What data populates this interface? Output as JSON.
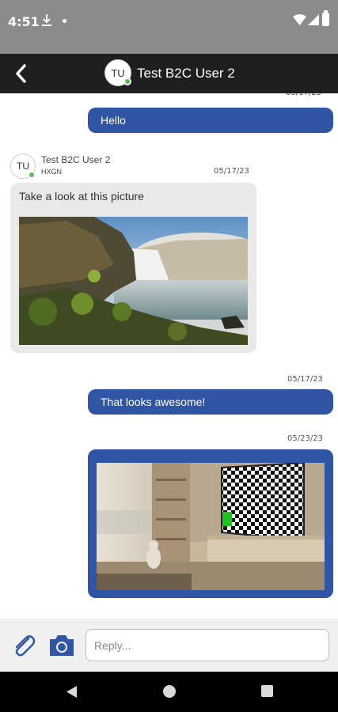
{
  "status_bar": {
    "time": "4:51",
    "icons": [
      "download-icon",
      "dot-icon",
      "wifi-icon",
      "signal-icon",
      "battery-icon"
    ]
  },
  "header": {
    "avatar_initials": "TU",
    "title": "Test B2C User 2",
    "back_icon": "chevron-left-icon",
    "background": "#1f1f1f"
  },
  "messages": [
    {
      "direction": "outgoing",
      "text": "Hello"
    },
    {
      "direction": "incoming",
      "sender": {
        "initials": "TU",
        "name": "Test B2C User 2",
        "org": "HXGN"
      },
      "timestamp": "05/17/23",
      "text": "Take a look at this picture",
      "image": "waterfall-photo"
    },
    {
      "direction": "outgoing",
      "timestamp": "05/17/23",
      "text": "That looks awesome!"
    },
    {
      "direction": "outgoing",
      "timestamp": "05/23/23",
      "image": "room-tv-photo"
    }
  ],
  "composer": {
    "placeholder": "Reply...",
    "value": "",
    "attach_icon": "paperclip-icon",
    "camera_icon": "camera-icon"
  },
  "nav_bar": {
    "buttons": [
      "back-triangle-icon",
      "home-circle-icon",
      "recents-square-icon"
    ]
  },
  "colors": {
    "accent": "#2f55a4",
    "incoming_bubble": "#e9e9e9",
    "status_bar": "#8b8b8b",
    "online": "#5cb85c"
  }
}
